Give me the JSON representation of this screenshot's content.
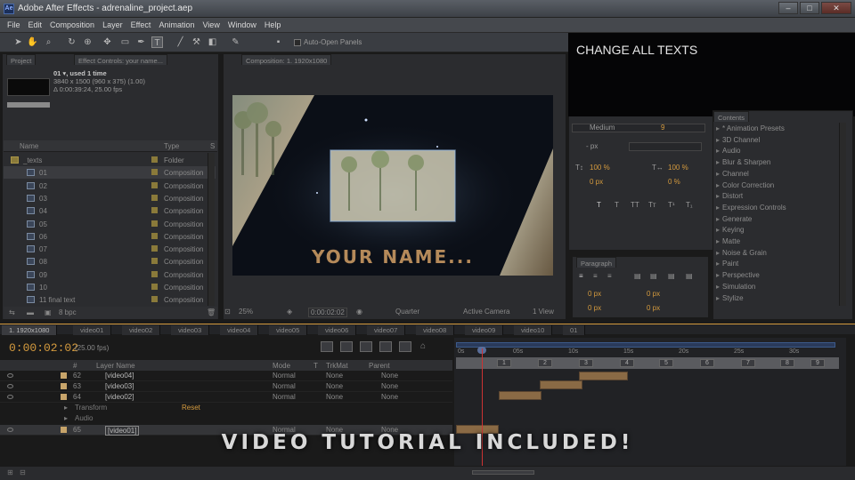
{
  "window": {
    "title": "Adobe After Effects - adrenaline_project.aep",
    "icon_text": "Ae"
  },
  "menu": [
    "File",
    "Edit",
    "Composition",
    "Layer",
    "Effect",
    "Animation",
    "View",
    "Window",
    "Help"
  ],
  "toolbar": {
    "auto_open_panels": "Auto-Open Panels"
  },
  "project_panel": {
    "tab": "Project",
    "effect_controls_tab": "Effect Controls: your name...",
    "item_line1": "01 ▾, used 1 time",
    "item_line2": "3840 x 1500  (960 x 375) (1.00)",
    "item_line3": "Δ 0:00:39:24, 25.00 fps",
    "col_name": "Name",
    "col_type": "Type",
    "col_s": "S",
    "rows": [
      {
        "name": "_texts",
        "type": "Folder",
        "folder": true
      },
      {
        "name": "01",
        "type": "Composition"
      },
      {
        "name": "02",
        "type": "Composition"
      },
      {
        "name": "03",
        "type": "Composition"
      },
      {
        "name": "04",
        "type": "Composition"
      },
      {
        "name": "05",
        "type": "Composition"
      },
      {
        "name": "06",
        "type": "Composition"
      },
      {
        "name": "07",
        "type": "Composition"
      },
      {
        "name": "08",
        "type": "Composition"
      },
      {
        "name": "09",
        "type": "Composition"
      },
      {
        "name": "10",
        "type": "Composition"
      },
      {
        "name": "11 final text",
        "type": "Composition"
      }
    ],
    "footer_bpc": "8 bpc"
  },
  "composition_panel": {
    "tab": "Composition: 1. 1920x1080",
    "preview_text": "YOUR NAME...",
    "zoom": "25%",
    "timecode": "0:00:02:02",
    "resolution": "Quarter",
    "camera": "Active Camera",
    "views": "1 View"
  },
  "character_panel": {
    "overlay_text": "CHANGE ALL TEXTS",
    "font_style": "Medium",
    "font_size": "9",
    "unit_px": "- px",
    "vscale": "100 %",
    "hscale": "100 %",
    "baseline": "0 px",
    "tsume": "0 %"
  },
  "paragraph_panel": {
    "tab": "Paragraph",
    "indent_left": "0 px",
    "indent_right": "0 px",
    "indent_first": "0 px",
    "space_before": "0 px",
    "space_after": "0 px"
  },
  "effects_panel": {
    "tab": "Contents",
    "items": [
      "* Animation Presets",
      "3D Channel",
      "Audio",
      "Blur & Sharpen",
      "Channel",
      "Color Correction",
      "Distort",
      "Expression Controls",
      "Generate",
      "Keying",
      "Matte",
      "Noise & Grain",
      "Paint",
      "Perspective",
      "Simulation",
      "Stylize"
    ]
  },
  "timeline": {
    "tabs": [
      "1. 1920x1080",
      "video01",
      "video02",
      "video03",
      "video04",
      "video05",
      "video06",
      "video07",
      "video08",
      "video09",
      "video10",
      "01"
    ],
    "timecode": "0:00:02:02",
    "fps": "(25.00 fps)",
    "headers": {
      "num": "#",
      "layer_name": "Layer Name",
      "mode": "Mode",
      "t": "T",
      "trkmat": "TrkMat",
      "parent": "Parent"
    },
    "layers": [
      {
        "num": "62",
        "name": "[video04]",
        "mode": "Normal",
        "trkmat": "None",
        "parent": "None"
      },
      {
        "num": "63",
        "name": "[video03]",
        "mode": "Normal",
        "trkmat": "None",
        "parent": "None"
      },
      {
        "num": "64",
        "name": "[video02]",
        "mode": "Normal",
        "trkmat": "None",
        "parent": "None"
      },
      {
        "num": "65",
        "name": "[video01]",
        "mode": "Normal",
        "trkmat": "None",
        "parent": "None"
      }
    ],
    "props": {
      "transform": "Transform",
      "reset": "Reset",
      "audio": "Audio"
    },
    "ruler": [
      "0s",
      "05s",
      "10s",
      "15s",
      "20s",
      "25s",
      "30s"
    ],
    "markers": [
      "1",
      "2",
      "3",
      "4",
      "5",
      "6",
      "7",
      "8",
      "9"
    ]
  },
  "overlay": {
    "tutorial": "VIDEO TUTORIAL INCLUDED!"
  }
}
